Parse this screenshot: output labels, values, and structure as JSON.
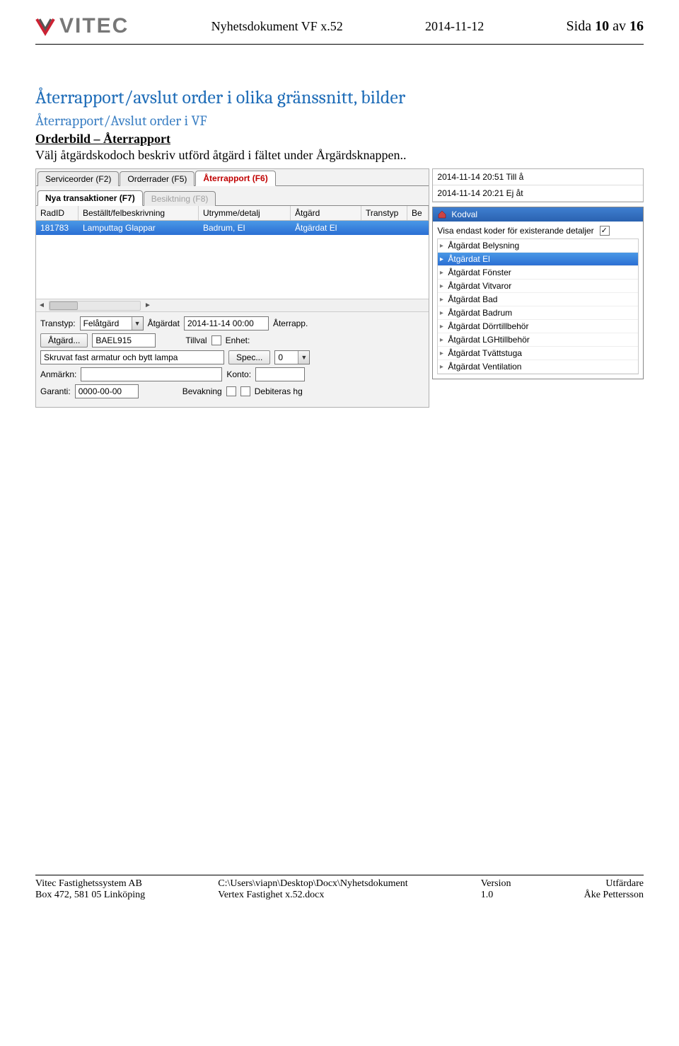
{
  "header": {
    "logo_text": "VITEC",
    "doc_title": "Nyhetsdokument VF x.52",
    "date": "2014-11-12",
    "page_label_prefix": "Sida ",
    "page_num": "10",
    "page_of": " av ",
    "page_total": "16"
  },
  "heading1": "Återrapport/avslut order i olika gränssnitt, bilder",
  "heading2": "Återrapport/Avslut order i VF",
  "heading3": "Orderbild – Återrapport",
  "paragraph": "Välj åtgärdskodoch beskriv utförd åtgärd i fältet under Årgärdsknappen..",
  "ui": {
    "tabs1": {
      "t1": "Serviceorder (F2)",
      "t2": "Orderrader (F5)",
      "t3": "Återrapport (F6)"
    },
    "tabs2": {
      "t1": "Nya transaktioner (F7)",
      "t2": "Besiktning (F8)"
    },
    "columns": {
      "c1": "RadID",
      "c2": "Beställt/felbeskrivning",
      "c3": "Utrymme/detalj",
      "c4": "Åtgärd",
      "c5": "Transtyp",
      "c6": "Be"
    },
    "row": {
      "c1": "181783",
      "c2": "Lamputtag Glappar",
      "c3": "Badrum, El",
      "c4": "Åtgärdat El",
      "c5": "",
      "c6": ""
    },
    "form": {
      "transtyp_lbl": "Transtyp:",
      "transtyp_val": "Felåtgärd",
      "atgardat_lbl": "Åtgärdat",
      "atgardat_val": "2014-11-14 00:00",
      "aterrapp_lbl": "Återrapp.",
      "atgard_btn": "Åtgärd...",
      "atgard_val": "BAEL915",
      "tillval_lbl": "Tillval",
      "enhet_lbl": "Enhet:",
      "desc_val": "Skruvat fast armatur och bytt lampa",
      "spec_btn": "Spec...",
      "qty_val": "0",
      "anmarkn_lbl": "Anmärkn:",
      "konto_lbl": "Konto:",
      "garanti_lbl": "Garanti:",
      "garanti_val": "0000-00-00",
      "bevakning_lbl": "Bevakning",
      "debiteras_lbl": "Debiteras hg"
    },
    "timebox": {
      "line1": "2014-11-14 20:51 Till å",
      "line2": "2014-11-14 20:21 Ej åt"
    },
    "kodval": {
      "title": "Kodval",
      "filter_label": "Visa endast koder för existerande detaljer",
      "items": [
        "Åtgärdat Belysning",
        "Åtgärdat El",
        "Åtgärdat Fönster",
        "Åtgärdat Vitvaror",
        "Åtgärdat Bad",
        "Åtgärdat Badrum",
        "Åtgärdat Dörrtillbehör",
        "Åtgärdat LGHtillbehör",
        "Åtgärdat Tvättstuga",
        "Åtgärdat Ventilation"
      ],
      "selected_index": 1
    }
  },
  "footer": {
    "company": "Vitec Fastighetssystem AB",
    "address": "Box 472, 581 05 Linköping",
    "path": "C:\\Users\\viapn\\Desktop\\Docx\\Nyhetsdokument",
    "filename": "Vertex Fastighet x.52.docx",
    "version_lbl": "Version",
    "version_val": "1.0",
    "utfardare_lbl": "Utfärdare",
    "utfardare_val": "Åke Pettersson"
  }
}
